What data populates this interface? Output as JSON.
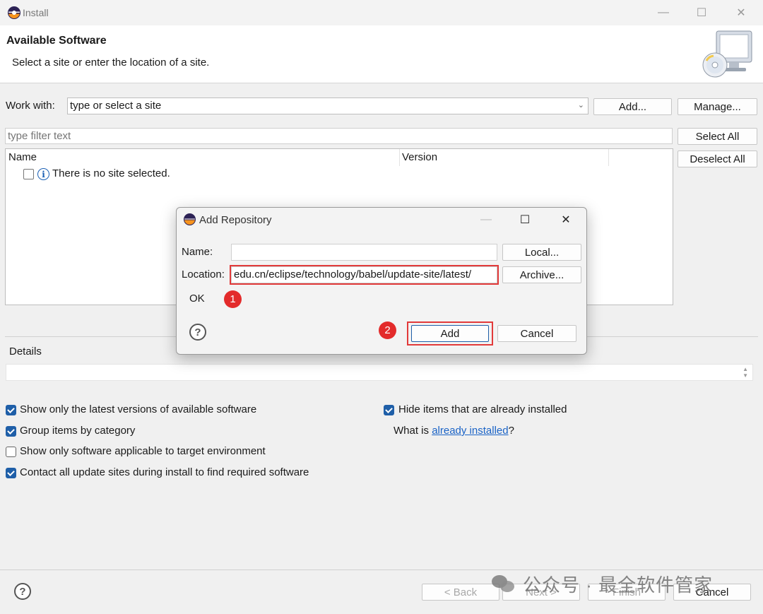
{
  "window": {
    "title": "Install",
    "icon": "eclipse-icon",
    "controls": {
      "minimize": "—",
      "maximize": "☐",
      "close": "✕"
    }
  },
  "header": {
    "title": "Available Software",
    "description": "Select a site or enter the location of a site.",
    "graphic": "install-cd-monitor-icon"
  },
  "work_with": {
    "label": "Work with:",
    "combo_value": "type or select a site",
    "add_button": "Add...",
    "manage_button": "Manage..."
  },
  "filter": {
    "placeholder": "type filter text"
  },
  "side_buttons": {
    "select_all": "Select All",
    "deselect_all": "Deselect All"
  },
  "table": {
    "columns": [
      "Name",
      "Version"
    ],
    "rows": [
      {
        "checked": false,
        "icon": "info-icon",
        "text": "There is no site selected."
      }
    ]
  },
  "details": {
    "label": "Details"
  },
  "options": {
    "left": [
      {
        "label": "Show only the latest versions of available software",
        "checked": true
      },
      {
        "label": "Group items by category",
        "checked": true
      },
      {
        "label": "Show only software applicable to target environment",
        "checked": false
      },
      {
        "label": "Contact all update sites during install to find required software",
        "checked": true
      }
    ],
    "right": {
      "hide_installed": {
        "label": "Hide items that are already installed",
        "checked": true
      },
      "what_is_prefix": "What is ",
      "what_is_link": "already installed",
      "what_is_suffix": "?"
    }
  },
  "footer": {
    "back": "< Back",
    "next": "Next >",
    "finish": "Finish",
    "cancel": "Cancel"
  },
  "watermark": {
    "text": "公众号 · 最全软件管家"
  },
  "dialog": {
    "title": "Add Repository",
    "name_label": "Name:",
    "name_value": "",
    "location_label": "Location:",
    "location_value": "edu.cn/eclipse/technology/babel/update-site/latest/",
    "local_button": "Local...",
    "archive_button": "Archive...",
    "status_text": "OK",
    "add_button": "Add",
    "cancel_button": "Cancel",
    "annotations": [
      "1",
      "2"
    ],
    "annotation_color": "#e32b2b"
  },
  "colors": {
    "accent": "#1f5fa8",
    "link": "#1a63c6",
    "highlight": "#e23a3a"
  }
}
